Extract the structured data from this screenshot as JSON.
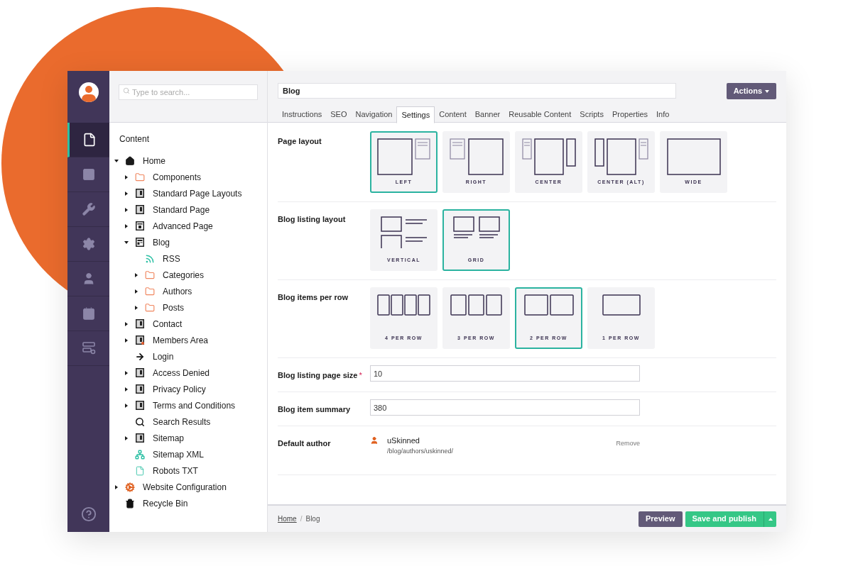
{
  "search": {
    "placeholder": "Type to search..."
  },
  "rail": [
    {
      "kind": "content",
      "selected": true
    },
    {
      "kind": "media",
      "selected": false
    },
    {
      "kind": "wrench",
      "selected": false
    },
    {
      "kind": "gear",
      "selected": false
    },
    {
      "kind": "user",
      "selected": false
    },
    {
      "kind": "card",
      "selected": false
    },
    {
      "kind": "form",
      "selected": false
    }
  ],
  "tree": {
    "title": "Content",
    "items": [
      {
        "label": "Home",
        "kind": "home",
        "expanded": true,
        "children": [
          {
            "label": "Components",
            "kind": "folder",
            "expanded": false
          },
          {
            "label": "Standard Page Layouts",
            "kind": "page",
            "expanded": false
          },
          {
            "label": "Standard Page",
            "kind": "page",
            "expanded": false
          },
          {
            "label": "Advanced Page",
            "kind": "advanced",
            "expanded": false
          },
          {
            "label": "Blog",
            "kind": "blog",
            "expanded": true,
            "children": [
              {
                "label": "RSS",
                "kind": "rss"
              },
              {
                "label": "Categories",
                "kind": "folder",
                "expanded": false
              },
              {
                "label": "Authors",
                "kind": "folder",
                "expanded": false
              },
              {
                "label": "Posts",
                "kind": "folder",
                "expanded": false
              }
            ]
          },
          {
            "label": "Contact",
            "kind": "page",
            "expanded": false
          },
          {
            "label": "Members Area",
            "kind": "member",
            "expanded": false
          },
          {
            "label": "Login",
            "kind": "arrow"
          },
          {
            "label": "Access Denied",
            "kind": "page",
            "expanded": false
          },
          {
            "label": "Privacy Policy",
            "kind": "page",
            "expanded": false
          },
          {
            "label": "Terms and Conditions",
            "kind": "page",
            "expanded": false
          },
          {
            "label": "Search Results",
            "kind": "search"
          },
          {
            "label": "Sitemap",
            "kind": "page",
            "expanded": false
          },
          {
            "label": "Sitemap XML",
            "kind": "sitemap"
          },
          {
            "label": "Robots TXT",
            "kind": "file"
          }
        ]
      },
      {
        "label": "Website Configuration",
        "kind": "config",
        "expanded": false
      },
      {
        "label": "Recycle Bin",
        "kind": "trash"
      }
    ]
  },
  "name_field": {
    "value": "Blog"
  },
  "actions_button": {
    "label": "Actions"
  },
  "tabs": [
    {
      "label": "Instructions",
      "selected": false
    },
    {
      "label": "SEO",
      "selected": false
    },
    {
      "label": "Navigation",
      "selected": false
    },
    {
      "label": "Settings",
      "selected": true
    },
    {
      "label": "Content",
      "selected": false
    },
    {
      "label": "Banner",
      "selected": false
    },
    {
      "label": "Reusable Content",
      "selected": false
    },
    {
      "label": "Scripts",
      "selected": false
    },
    {
      "label": "Properties",
      "selected": false
    },
    {
      "label": "Info",
      "selected": false
    }
  ],
  "properties": [
    {
      "kind": "picker",
      "label": "Page layout",
      "options": [
        {
          "label": "LEFT",
          "kind": "left",
          "selected": true
        },
        {
          "label": "RIGHT",
          "kind": "right",
          "selected": false
        },
        {
          "label": "CENTER",
          "kind": "center",
          "selected": false
        },
        {
          "label": "CENTER (ALT)",
          "kind": "center_alt",
          "selected": false
        },
        {
          "label": "WIDE",
          "kind": "wide",
          "selected": false
        }
      ]
    },
    {
      "kind": "picker",
      "label": "Blog listing layout",
      "options": [
        {
          "label": "VERTICAL",
          "kind": "vertical",
          "selected": false
        },
        {
          "label": "GRID",
          "kind": "grid",
          "selected": true
        }
      ]
    },
    {
      "kind": "picker",
      "label": "Blog items per row",
      "options": [
        {
          "label": "4 PER ROW",
          "kind": "per4",
          "selected": false
        },
        {
          "label": "3 PER ROW",
          "kind": "per3",
          "selected": false
        },
        {
          "label": "2 PER ROW",
          "kind": "per2",
          "selected": true
        },
        {
          "label": "1 PER ROW",
          "kind": "per1",
          "selected": false
        }
      ]
    },
    {
      "kind": "text",
      "label": "Blog listing page size",
      "required_mark": "*",
      "value": "10"
    },
    {
      "kind": "text",
      "label": "Blog item summary",
      "value": "380"
    },
    {
      "kind": "author",
      "label": "Default author",
      "name": "uSkinned",
      "path": "/blog/authors/uskinned/",
      "remove": "Remove"
    }
  ],
  "breadcrumb": [
    {
      "label": "Home",
      "link": true
    },
    {
      "label": "Blog",
      "link": false
    }
  ],
  "separator": "/",
  "preview_button": {
    "label": "Preview"
  },
  "publish_button": {
    "label": "Save and publish"
  }
}
